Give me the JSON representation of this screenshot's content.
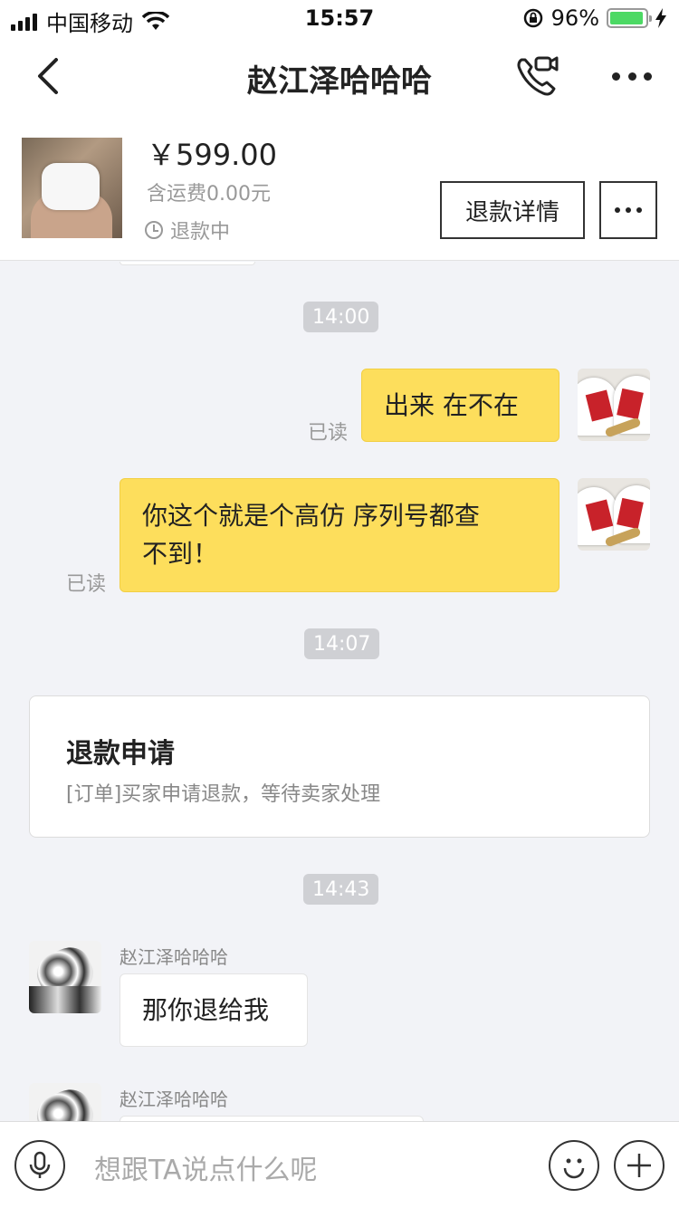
{
  "status_bar": {
    "carrier": "中国移动",
    "time": "15:57",
    "battery": "96%",
    "battery_level": 0.96
  },
  "nav": {
    "title": "赵江泽哈哈哈"
  },
  "product": {
    "price": "￥599.00",
    "shipping": "含运费0.00元",
    "status": "退款中",
    "refund_button": "退款详情"
  },
  "chat": {
    "time_1": "14:00",
    "msg_1": "出来 在不在",
    "read_1": "已读",
    "msg_2_line1": "你这个就是个高仿  序列号都查",
    "msg_2_line2": "不到！",
    "read_2": "已读",
    "time_2": "14:07",
    "card_title": "退款申请",
    "card_text": "[订单]买家申请退款，等待卖家处理",
    "time_3": "14:43",
    "sender_1": "赵江泽哈哈哈",
    "msg_3": "那你退给我",
    "sender_2": "赵江泽哈哈哈"
  },
  "input": {
    "placeholder": "想跟TA说点什么呢"
  },
  "colors": {
    "my_bubble": "#fdde5c",
    "background": "#f2f3f7",
    "battery": "#4cd964"
  }
}
